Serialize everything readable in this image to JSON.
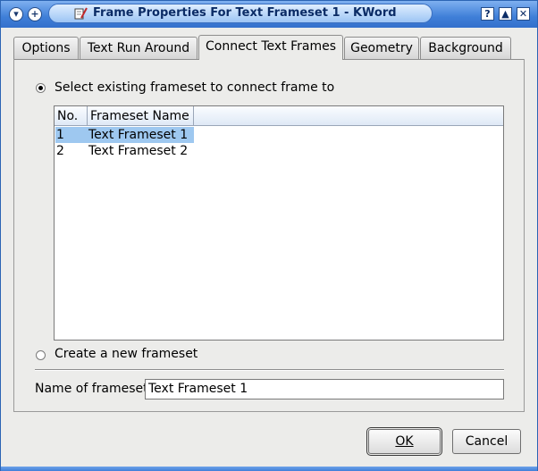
{
  "window": {
    "title": "Frame Properties For Text Frameset 1 - KWord",
    "menu_icon": "chevron-down-icon",
    "sticky_icon": "plus-icon",
    "help_label": "?",
    "shade_label": "▲",
    "close_label": "✕"
  },
  "tabs": [
    {
      "label": "Options",
      "active": false
    },
    {
      "label": "Text Run Around",
      "active": false
    },
    {
      "label": "Connect Text Frames",
      "active": true
    },
    {
      "label": "Geometry",
      "active": false
    },
    {
      "label": "Background",
      "active": false
    }
  ],
  "connect": {
    "existing_radio_label": "Select existing frameset to connect frame to",
    "existing_selected": true,
    "new_radio_label": "Create a new frameset",
    "new_selected": false,
    "list": {
      "columns": [
        "No.",
        "Frameset Name"
      ],
      "rows": [
        {
          "no": "1",
          "name": "Text Frameset 1",
          "selected": true
        },
        {
          "no": "2",
          "name": "Text Frameset 2",
          "selected": false
        }
      ]
    },
    "name_label": "Name of frameset:",
    "name_value": "Text Frameset 1"
  },
  "buttons": {
    "ok": "OK",
    "cancel": "Cancel"
  },
  "colors": {
    "titlebar": "#3f7fd8",
    "selection": "#9ec8f0"
  }
}
